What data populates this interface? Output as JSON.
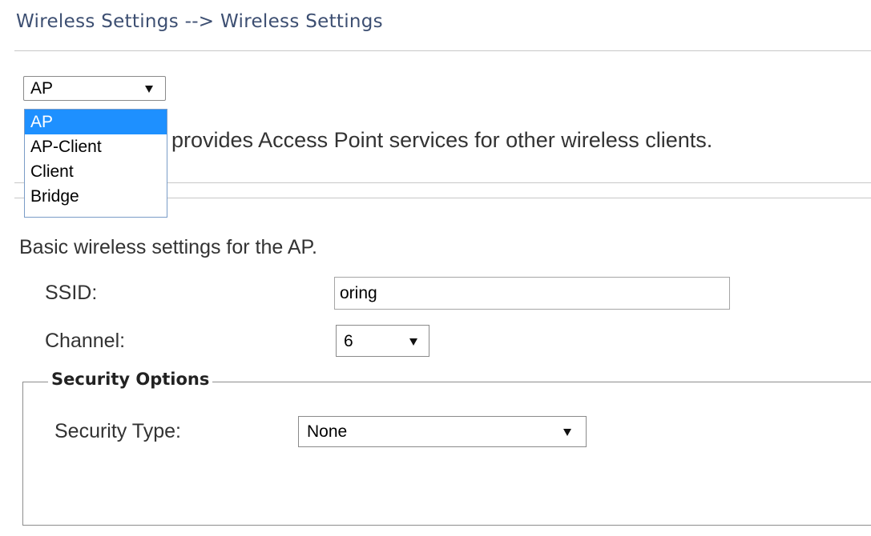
{
  "header": {
    "title": "Wireless Settings --> Wireless Settings"
  },
  "mode": {
    "selected": "AP",
    "options": [
      "AP",
      "AP-Client",
      "Client",
      "Bridge"
    ],
    "description": "provides Access Point services for other wireless clients."
  },
  "basic": {
    "description": "Basic wireless settings for the AP.",
    "ssid_label": "SSID:",
    "ssid_value": "oring",
    "channel_label": "Channel:",
    "channel_value": "6"
  },
  "security": {
    "legend": "Security Options",
    "type_label": "Security Type:",
    "type_value": "None"
  },
  "icons": {
    "dropdown_caret": "caret-down-icon"
  }
}
